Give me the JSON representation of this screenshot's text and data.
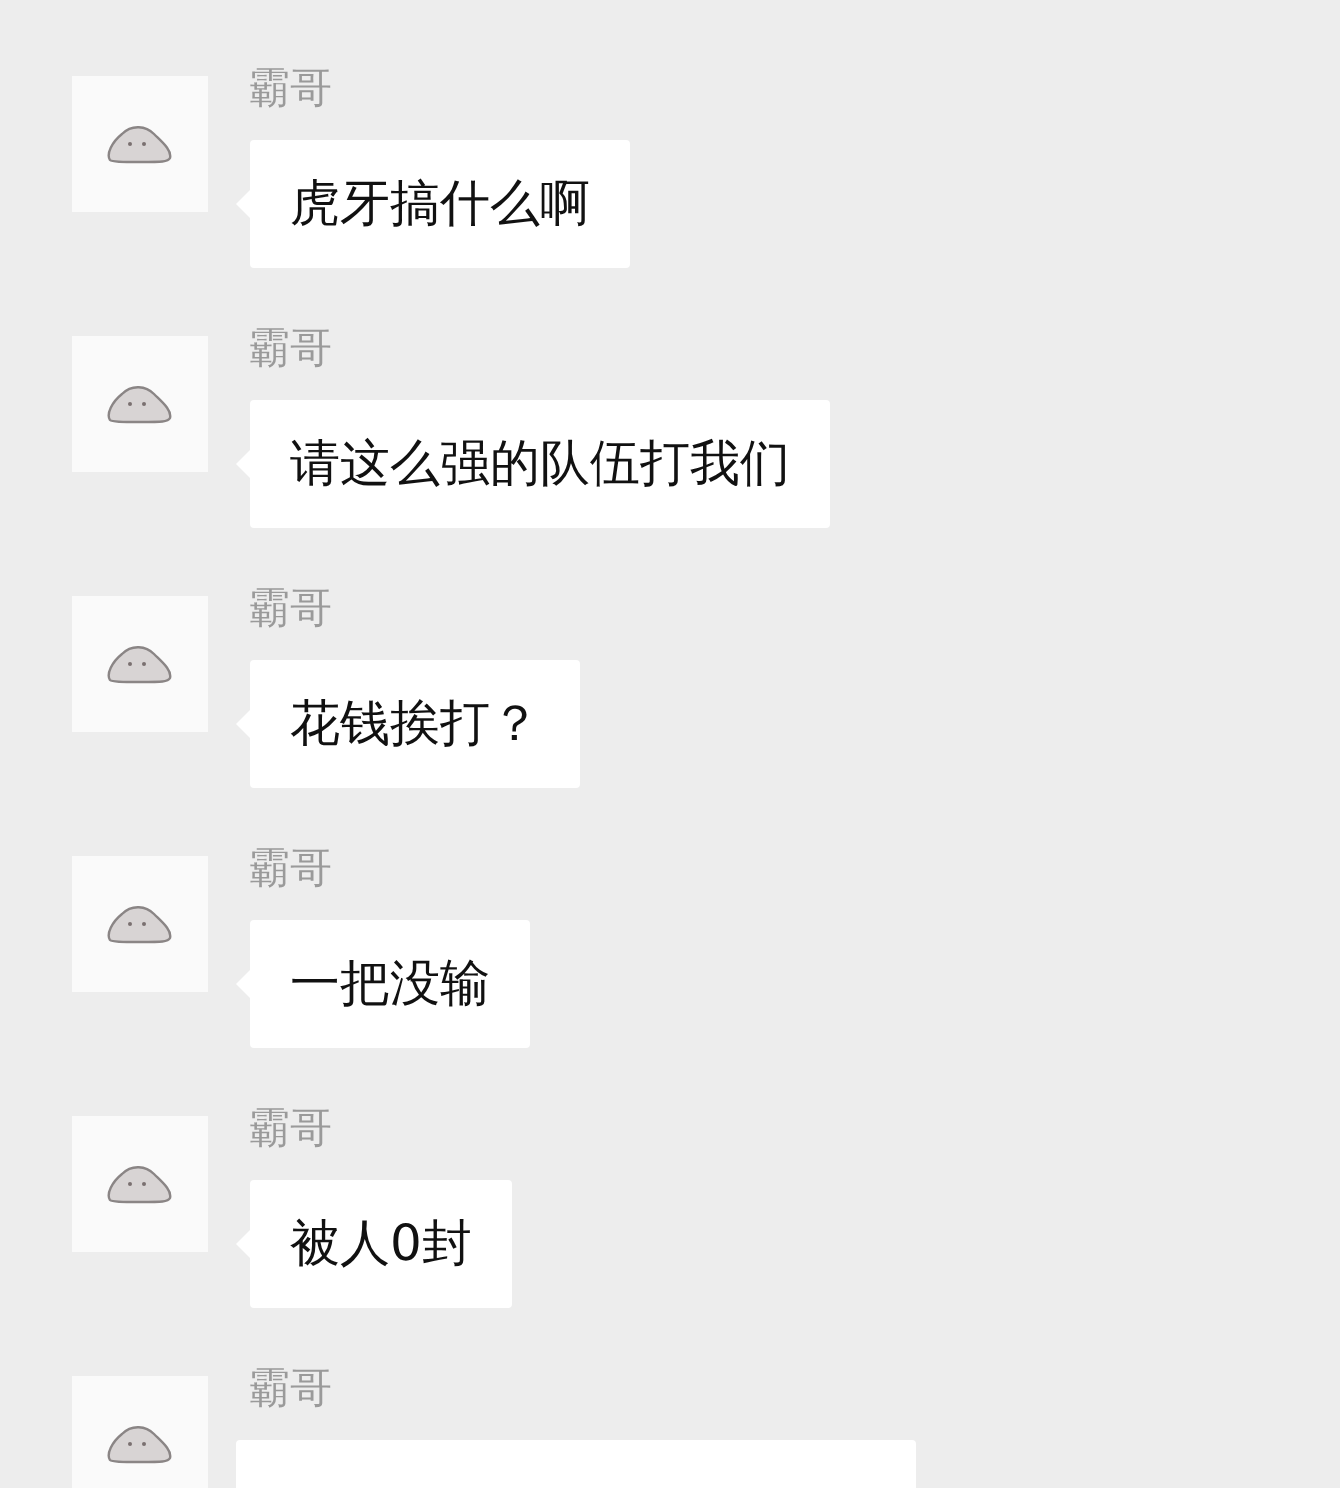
{
  "messages": [
    {
      "sender": "霸哥",
      "text": "虎牙搞什么啊"
    },
    {
      "sender": "霸哥",
      "text": "请这么强的队伍打我们"
    },
    {
      "sender": "霸哥",
      "text": "花钱挨打？"
    },
    {
      "sender": "霸哥",
      "text": "一把没输"
    },
    {
      "sender": "霸哥",
      "text": "被人0封"
    },
    {
      "sender": "霸哥"
    }
  ]
}
